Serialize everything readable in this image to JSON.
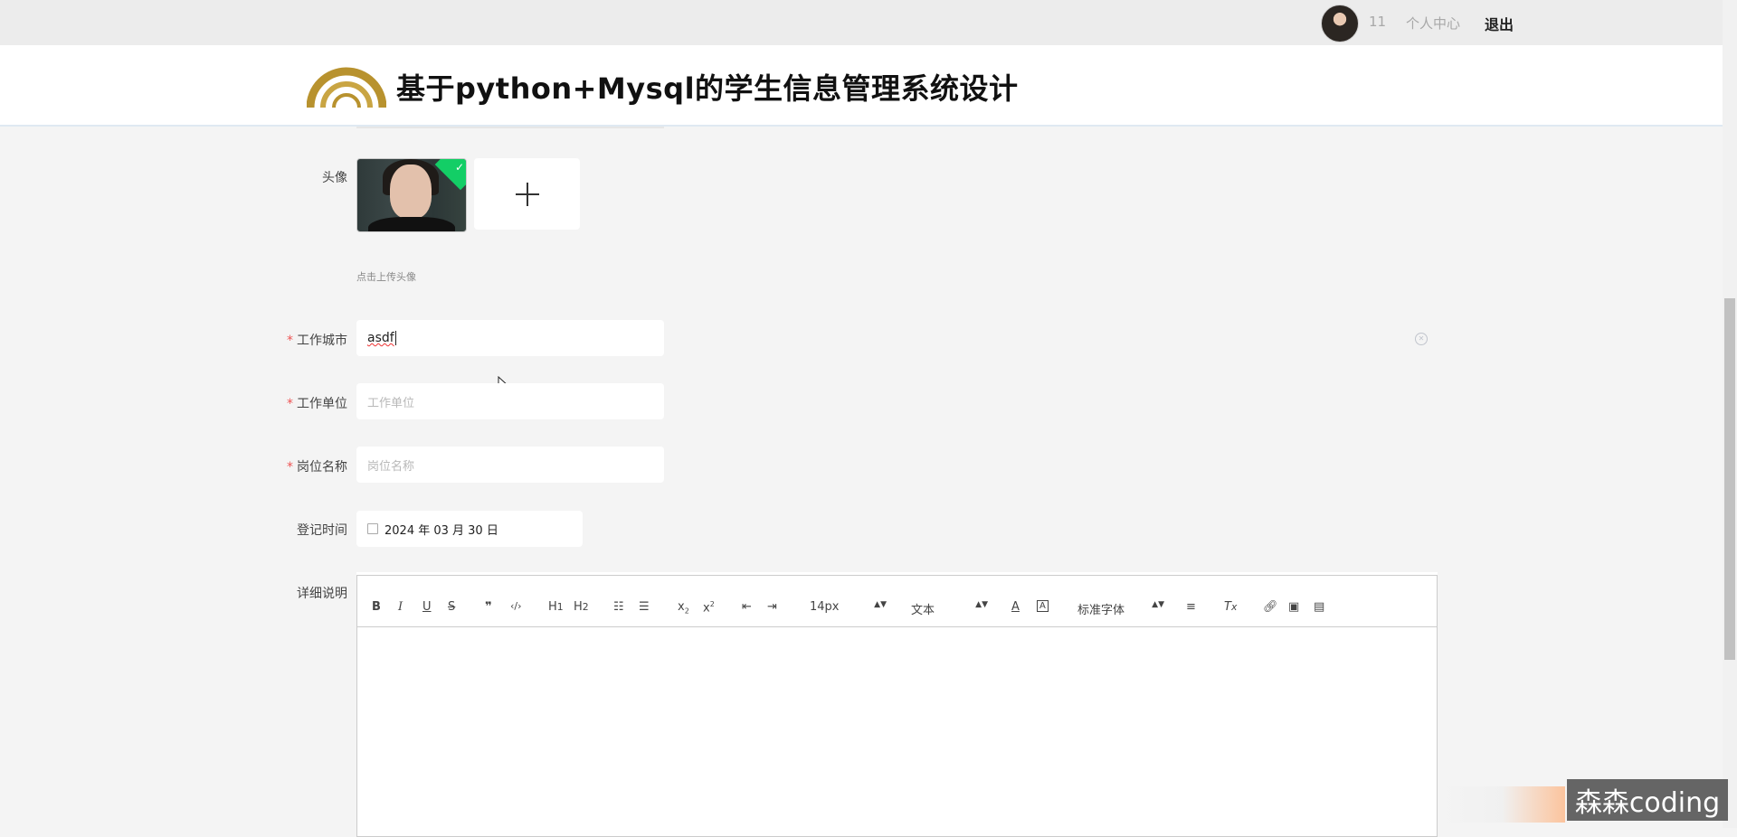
{
  "topbar": {
    "user_name": "11",
    "profile_link": "个人中心",
    "logout": "退出"
  },
  "header": {
    "title": "基于python+Mysql的学生信息管理系统设计"
  },
  "form": {
    "avatar": {
      "label": "头像",
      "upload_tip": "点击上传头像",
      "upload_icon": "plus-icon"
    },
    "work_city": {
      "label": "工作城市",
      "required": "*",
      "value": "asdf"
    },
    "work_unit": {
      "label": "工作单位",
      "required": "*",
      "placeholder": "工作单位"
    },
    "position_name": {
      "label": "岗位名称",
      "required": "*",
      "placeholder": "岗位名称"
    },
    "register_time": {
      "label": "登记时间",
      "value": "2024 年 03 月 30 日"
    },
    "details": {
      "label": "详细说明"
    }
  },
  "editor": {
    "font_size": "14px",
    "header_type": "文本",
    "font_family": "标准字体",
    "toolbar_icons": [
      "bold-icon",
      "italic-icon",
      "underline-icon",
      "strike-icon",
      "blockquote-icon",
      "code-icon",
      "h1-icon",
      "h2-icon",
      "ordered-list-icon",
      "bullet-list-icon",
      "subscript-icon",
      "superscript-icon",
      "outdent-icon",
      "indent-icon",
      "font-color-icon",
      "background-color-icon",
      "align-icon",
      "clear-format-icon",
      "link-icon",
      "image-icon",
      "video-icon"
    ]
  },
  "watermark": "森森coding",
  "colors": {
    "accent_required": "#ee5555",
    "logo_gold": "#b8922e",
    "upload_success": "#13ce66"
  }
}
